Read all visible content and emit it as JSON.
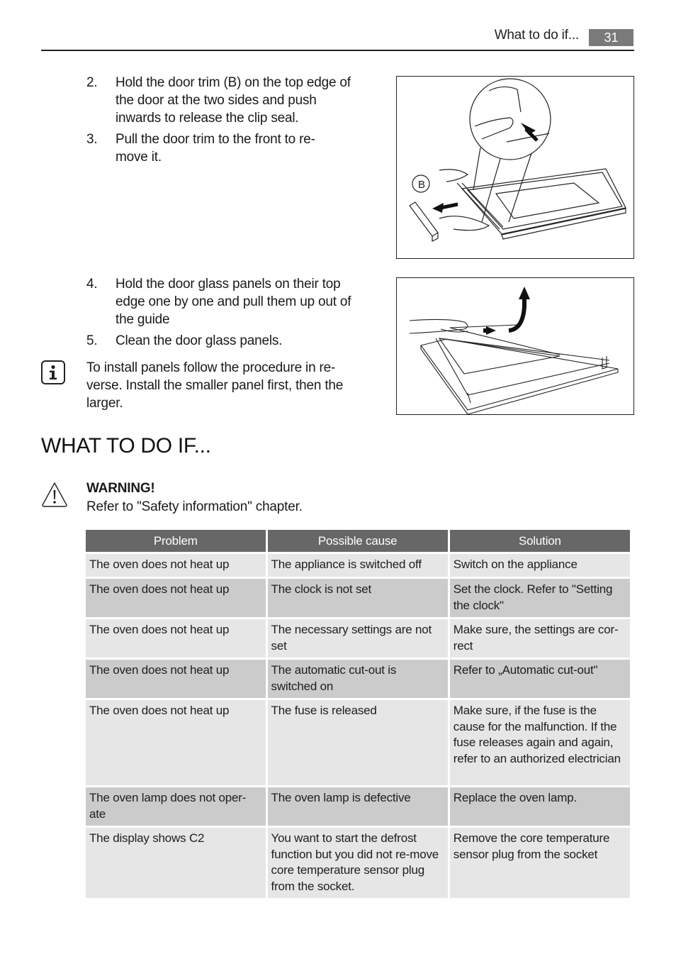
{
  "header": {
    "section": "What to do if...",
    "page_number": "31"
  },
  "steps_top": [
    {
      "num": "2.",
      "text": "Hold the door trim (B) on the top edge of the door at the two sides and push inwards to release the clip seal."
    },
    {
      "num": "3.",
      "text": "Pull the door trim to the front to re-move it."
    }
  ],
  "figure1": {
    "label_b": "B",
    "alt": "door-trim-removal-illustration"
  },
  "steps_bottom": [
    {
      "num": "4.",
      "text": "Hold the door glass panels on their top edge one by one and pull them up out of the guide"
    },
    {
      "num": "5.",
      "text": "Clean the door glass panels."
    }
  ],
  "figure2": {
    "alt": "glass-panel-removal-illustration"
  },
  "info_note": {
    "icon": "info-icon",
    "text": "To install panels follow the procedure in re-verse. Install the smaller panel first, then the larger."
  },
  "section_title": "WHAT TO DO IF...",
  "warning": {
    "icon": "warning-triangle-icon",
    "title": "WARNING!",
    "text": "Refer to \"Safety information\" chapter."
  },
  "table": {
    "headers": [
      "Problem",
      "Possible cause",
      "Solution"
    ],
    "rows": [
      {
        "problem": "The oven does not heat up",
        "cause": "The appliance is switched off",
        "solution": "Switch on the appliance"
      },
      {
        "problem": "The oven does not heat up",
        "cause": "The clock is not set",
        "solution": "Set the clock. Refer to \"Setting the clock\""
      },
      {
        "problem": "The oven does not heat up",
        "cause": "The necessary settings are not set",
        "solution": "Make sure, the settings are cor-rect"
      },
      {
        "problem": "The oven does not heat up",
        "cause": "The automatic cut-out is switched on",
        "solution": "Refer to „Automatic cut-out\""
      },
      {
        "problem": "The oven does not heat up",
        "cause": "The fuse is released",
        "solution": "Make sure, if the fuse is the cause for the malfunction. If the fuse releases again and again, refer to an authorized electrician"
      },
      {
        "problem": "The oven lamp does not oper-ate",
        "cause": "The oven lamp is defective",
        "solution": "Replace the oven lamp."
      },
      {
        "problem": "The display shows C2",
        "cause": "You want to start the defrost function but you did not re-move core temperature sensor plug from the socket.",
        "solution": "Remove the core temperature sensor plug from the socket"
      }
    ]
  },
  "colors": {
    "header_fill": "#676767",
    "row_light": "#e6e6e6",
    "row_dark": "#cbcbcb",
    "page_badge": "#7a7a7a"
  }
}
